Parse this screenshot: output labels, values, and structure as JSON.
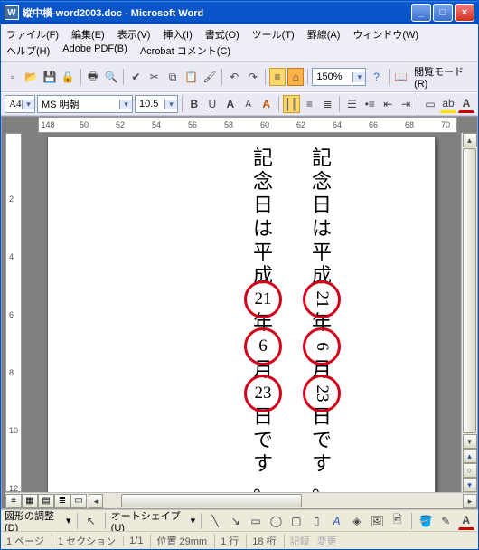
{
  "title": "縦中横-word2003.doc - Microsoft Word",
  "menu": {
    "file": "ファイル(F)",
    "edit": "編集(E)",
    "view": "表示(V)",
    "insert": "挿入(I)",
    "format": "書式(O)",
    "tools": "ツール(T)",
    "ruler": "罫線(A)",
    "window": "ウィンドウ(W)",
    "help": "ヘルプ(H)",
    "adobe": "Adobe PDF(B)",
    "acrobat": "Acrobat コメント(C)"
  },
  "toolbar": {
    "zoom": "150%",
    "readmode": "閲覧モード(R)",
    "style": "A4",
    "font": "MS 明朝",
    "size": "10.5"
  },
  "ruler_h": [
    "148",
    "50",
    "52",
    "54",
    "56",
    "58",
    "60",
    "62",
    "64",
    "66",
    "68",
    "70"
  ],
  "ruler_v": [
    "",
    "",
    "2",
    "",
    "4",
    "",
    "6",
    "",
    "8",
    "",
    "10",
    "",
    "12"
  ],
  "doc": {
    "col1": [
      "記",
      "念",
      "日",
      "は",
      "平",
      "成",
      "21",
      "年",
      "6",
      "月",
      "23",
      "日",
      "で",
      "す",
      "。"
    ],
    "col2": [
      "記",
      "念",
      "日",
      "は",
      "平",
      "成",
      "21",
      "年",
      "6",
      "月",
      "23",
      "日",
      "で",
      "す",
      "。"
    ],
    "circled_indices": [
      6,
      8,
      10
    ]
  },
  "drawbar": {
    "label": "図形の調整(D)",
    "autoshape": "オートシェイプ(U)"
  },
  "status": {
    "page": "1 ページ",
    "section": "1 セクション",
    "pages": "1/1",
    "pos": "位置  29mm",
    "line": "1 行",
    "col": "18 桁",
    "rec": "記録",
    "chg": "変更"
  }
}
